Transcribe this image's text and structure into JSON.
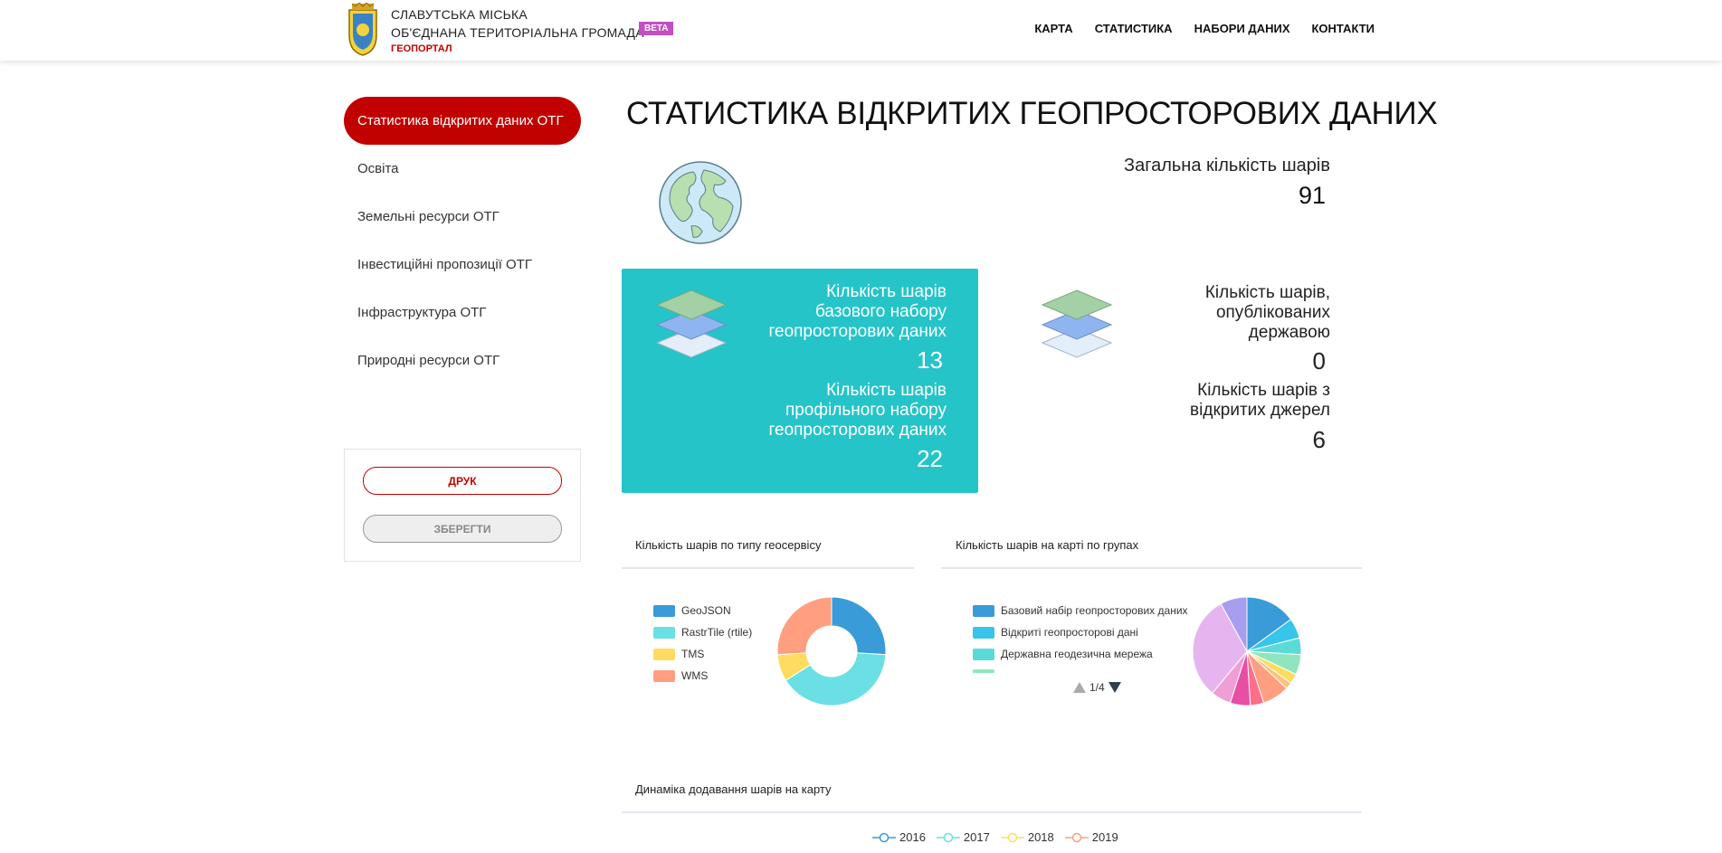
{
  "header": {
    "brand_line1": "СЛАВУТСЬКА МІСЬКА",
    "brand_line2": "ОБ'ЄДНАНА ТЕРИТОРІАЛЬНА ГРОМАДА",
    "brand_sub": "ГЕОПОРТАЛ",
    "beta": "BETA",
    "nav": [
      {
        "label": "КАРТА"
      },
      {
        "label": "СТАТИСТИКА"
      },
      {
        "label": "НАБОРИ ДАНИХ"
      },
      {
        "label": "КОНТАКТИ"
      }
    ]
  },
  "sidebar": {
    "items": [
      {
        "label": "Статистика відкритих даних ОТГ",
        "active": true
      },
      {
        "label": "Освіта"
      },
      {
        "label": "Земельні ресурси ОТГ"
      },
      {
        "label": "Інвестиційні пропозиції ОТГ"
      },
      {
        "label": "Інфраструктура ОТГ"
      },
      {
        "label": "Природні ресурси ОТГ"
      }
    ],
    "print_label": "ДРУК",
    "save_label": "ЗБЕРЕГТИ"
  },
  "main": {
    "title": "СТАТИСТИКА ВІДКРИТИХ ГЕОПРОСТОРОВИХ ДАНИХ",
    "total_label": "Загальна кількість шарів",
    "total_value": "91",
    "base": {
      "line1": "Кількість шарів",
      "line2": "базового набору",
      "line3": "геопросторових даних",
      "value": "13"
    },
    "profile": {
      "line1": "Кількість шарів",
      "line2": "профільного набору",
      "line3": "геопросторових даних",
      "value": "22"
    },
    "state": {
      "line1": "Кількість шарів,",
      "line2": "опублікованих",
      "line3": "державою",
      "value": "0"
    },
    "open": {
      "line1": "Кількість шарів з",
      "line2": "відкритих джерел",
      "value": "6"
    },
    "geoservice_title": "Кількість шарів по типу геосервісу",
    "groups_title": "Кількість шарів на карті по групах",
    "dynamics_title": "Динаміка додавання шарів на карту",
    "pager": "1/4"
  },
  "chart_data": [
    {
      "type": "pie",
      "title": "Кількість шарів по типу геосервісу",
      "donut": true,
      "legend_position": "left",
      "categories": [
        "GeoJSON",
        "RastrTile (rtile)",
        "TMS",
        "WMS"
      ],
      "values": [
        26,
        40,
        8,
        26
      ],
      "colors": [
        "#3a9bd9",
        "#6be0e4",
        "#ffdc60",
        "#ff9f7f"
      ]
    },
    {
      "type": "pie",
      "title": "Кількість шарів на карті по групах",
      "donut": false,
      "legend_position": "left",
      "legend_visible": [
        "Базовий набір геопросторових даних",
        "Відкриті геопросторові дані",
        "Державна геодезична мережа"
      ],
      "values": [
        15,
        6,
        5,
        6,
        3,
        2,
        8,
        4,
        6,
        6,
        31,
        8
      ],
      "colors": [
        "#3a9bd9",
        "#37c6ea",
        "#5adbd8",
        "#8fe6be",
        "#ffdc60",
        "#ffc27a",
        "#ff9f7f",
        "#ff6f8a",
        "#e84fa4",
        "#ef9ed6",
        "#e6b5f0",
        "#a79ef0"
      ]
    },
    {
      "type": "line",
      "title": "Динаміка додавання шарів на карту",
      "series": [
        {
          "name": "2016",
          "color": "#3a9bd9"
        },
        {
          "name": "2017",
          "color": "#6be0e4"
        },
        {
          "name": "2018",
          "color": "#ffdc60"
        },
        {
          "name": "2019",
          "color": "#ff9f7f"
        }
      ]
    }
  ]
}
